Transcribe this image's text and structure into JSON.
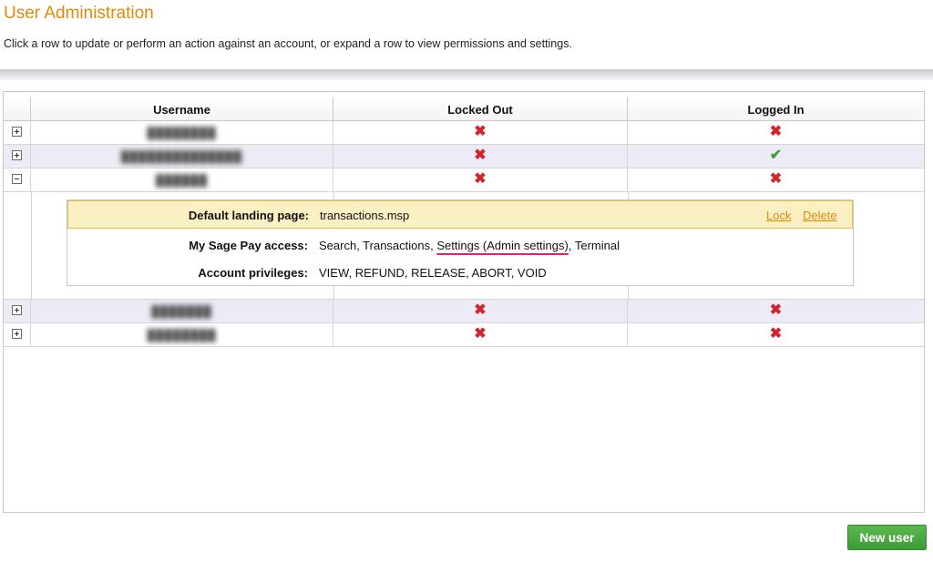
{
  "page": {
    "title": "User Administration",
    "description": "Click a row to update or perform an action against an account, or expand a row to view permissions and settings."
  },
  "table": {
    "columns": [
      "Username",
      "Locked Out",
      "Logged In"
    ],
    "rows": [
      {
        "username": "████████",
        "expanded": false,
        "locked_out": "✖",
        "logged_in": "✖"
      },
      {
        "username": "██████████████",
        "expanded": false,
        "locked_out": "✖",
        "logged_in": "✔"
      },
      {
        "username": "██████",
        "expanded": true,
        "locked_out": "✖",
        "logged_in": "✖"
      },
      {
        "username": "███████",
        "expanded": false,
        "locked_out": "✖",
        "logged_in": "✖"
      },
      {
        "username": "████████",
        "expanded": false,
        "locked_out": "✖",
        "logged_in": "✖"
      }
    ]
  },
  "details": {
    "landing_label": "Default landing page:",
    "landing_value": "transactions.msp",
    "lock_label": "Lock",
    "delete_label": "Delete",
    "access_label": "My Sage Pay access:",
    "access_part1": "Search, Transactions, ",
    "access_highlight": "Settings (Admin settings)",
    "access_part2": ", Terminal",
    "privileges_label": "Account privileges:",
    "privileges_value": "VIEW, REFUND, RELEASE, ABORT, VOID"
  },
  "actions": {
    "new_user_label": "New user"
  },
  "icons": {
    "expand": "plus-box-icon",
    "collapse": "minus-box-icon",
    "false_state": "cross-icon",
    "true_state": "check-icon"
  },
  "colors": {
    "accent_orange": "#e08a0b",
    "cross_red": "#d5232b",
    "check_green": "#4d9a3a",
    "button_green": "#4aa841",
    "row_alt": "#ecebf6",
    "detail_header_bg": "#fbf0c4"
  }
}
